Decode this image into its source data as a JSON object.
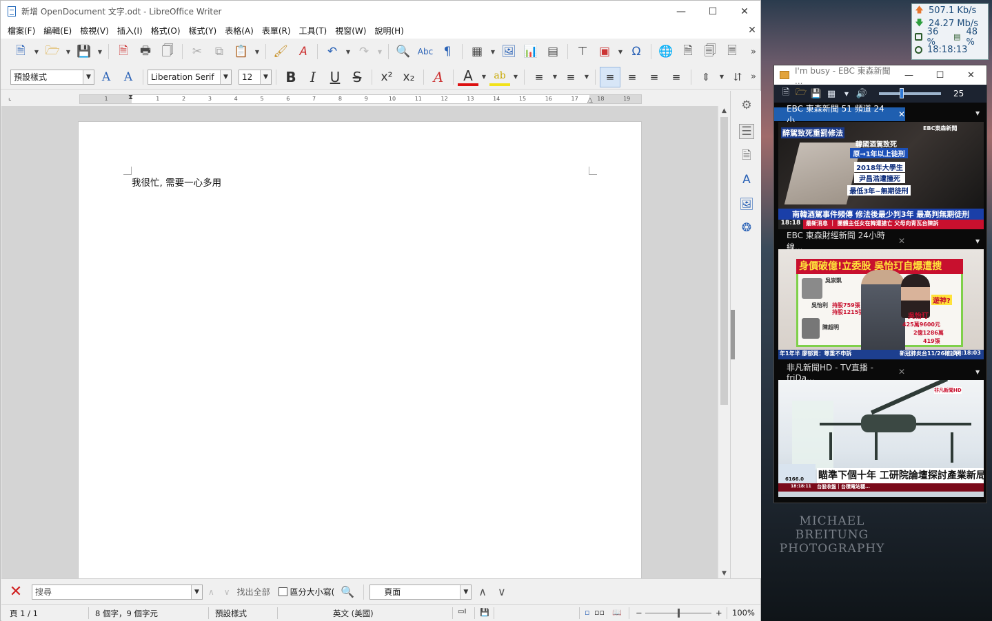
{
  "writer": {
    "title": "新增 OpenDocument 文字.odt - LibreOffice Writer",
    "menu": [
      "檔案(F)",
      "編輯(E)",
      "檢視(V)",
      "插入(I)",
      "格式(O)",
      "樣式(Y)",
      "表格(A)",
      "表單(R)",
      "工具(T)",
      "視窗(W)",
      "說明(H)"
    ],
    "para_style": "預設樣式",
    "font_name": "Liberation Serif",
    "font_size": "12",
    "ruler_ticks": [
      "1",
      "1",
      "2",
      "3",
      "4",
      "5",
      "6",
      "7",
      "8",
      "9",
      "10",
      "11",
      "12",
      "13",
      "14",
      "15",
      "16",
      "17",
      "18",
      "19"
    ],
    "document_text": "我很忙, 需要一心多用",
    "find": {
      "placeholder": "搜尋",
      "find_all": "找出全部",
      "match_case": "區分大小寫(",
      "nav_target": "頁面"
    },
    "status": {
      "page": "頁 1 / 1",
      "words": "8 個字，9 個字元",
      "style": "預設樣式",
      "language": "英文 (美國)",
      "zoom": "100%"
    }
  },
  "netmeter": {
    "upload": "507.1 Kb/s",
    "download": "24.27 Mb/s",
    "cpu": "36 %",
    "mem": "48 %",
    "time": "18:18:13",
    "colors": {
      "up": "#e8772e",
      "down": "#2e9e3e"
    }
  },
  "player": {
    "title": "I'm busy - EBC 東森新聞 ...",
    "volume": "25",
    "channels": [
      {
        "tab": "EBC 東森新聞 51 頻道 24 小...",
        "logo": "EBC東森新聞",
        "captions": [
          "醉駕致死重罰修法",
          "韓國酒駕致死",
          "原→1年以上徒刑",
          "2018年大學生",
          "尹昌浩遭撞死",
          "最低3年~無期徒刑"
        ],
        "headline": "南韓酒駕事件頻傳 修法後最少判3年 最高判無期徒刑",
        "clock": "18:18",
        "ticker": "最新消息 ｜ 團體主任女在韓遭搶亡 父母向青瓦台陳訴"
      },
      {
        "tab": "EBC 東森財經新聞 24小時線...",
        "headline": "身價破億!立委股 吳怡玎自爆遭搜",
        "names": [
          "吳崇凱",
          "吳怡利",
          "吳怡玎",
          "陳超明"
        ],
        "badge": "遊神?",
        "amounts": [
          "持股759張",
          "持股1215張",
          "25萬",
          "425萬9600元",
          "2億1286萬",
          "419張"
        ],
        "ticker": "年1年半  廖郁賢：尊重不申訴",
        "ticker2": "新冠肺炎台11/26確診例",
        "clock": "18:18:03"
      },
      {
        "tab": "非凡新聞HD - TV直播 - friDa...",
        "logo": "非凡新聞HD",
        "headline": "瞄準下個十年 工研院論壇探討產業新局",
        "ticker": "台股收盤｜台積電站穩…",
        "clock": "18:18:11",
        "index": "6166.0"
      }
    ]
  },
  "wallpaper": {
    "credit_line1": "MICHAEL BREITUNG",
    "credit_line2": "PHOTOGRAPHY"
  }
}
